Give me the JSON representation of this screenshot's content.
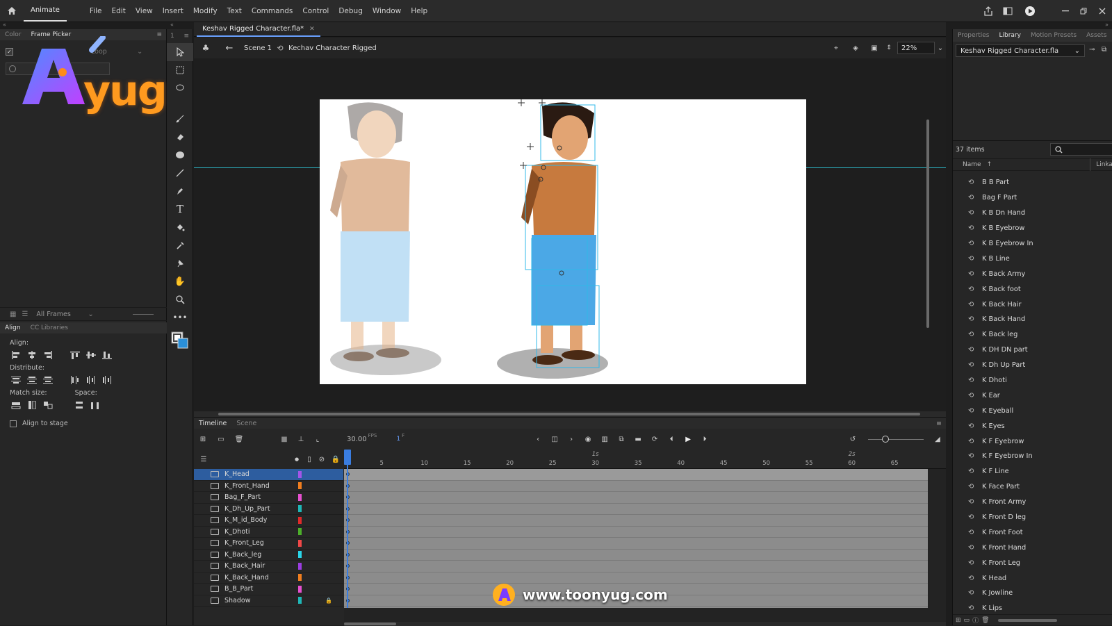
{
  "menubar": {
    "app_name": "Animate",
    "items": [
      "File",
      "Edit",
      "View",
      "Insert",
      "Modify",
      "Text",
      "Commands",
      "Control",
      "Debug",
      "Window",
      "Help"
    ]
  },
  "left_panel": {
    "tabs": [
      "Color",
      "Frame Picker"
    ],
    "loop_label": "Loop",
    "frames_filter": "All Frames",
    "align_tabs": [
      "Align",
      "CC Libraries"
    ],
    "align_label": "Align:",
    "distribute_label": "Distribute:",
    "match_size_label": "Match size:",
    "space_label": "Space:",
    "align_to_stage_label": "Align to stage"
  },
  "document": {
    "tab_title": "Keshav Rigged Character.fla*",
    "scene_label": "Scene 1",
    "symbol_label": "Kechav Character Rigged",
    "zoom": "22%"
  },
  "timeline": {
    "tabs": [
      "Timeline",
      "Scene"
    ],
    "fps_value": "30.00",
    "fps_unit": "FPS",
    "current_frame": "1",
    "frame_unit": "F",
    "ruler_ticks": [
      5,
      10,
      15,
      20,
      25,
      30,
      35,
      40,
      45,
      50,
      55,
      60,
      65
    ],
    "seconds_marks": [
      "1s",
      "2s"
    ],
    "layers": [
      {
        "name": "K_Head",
        "color": "#a255e8",
        "selected": true
      },
      {
        "name": "K_Front_Hand",
        "color": "#f07e1f",
        "selected": false
      },
      {
        "name": "Bag_F_Part",
        "color": "#e650d0",
        "selected": false
      },
      {
        "name": "K_Dh_Up_Part",
        "color": "#1fb7b7",
        "selected": false
      },
      {
        "name": "K_M_id_Body",
        "color": "#e02a2a",
        "selected": false
      },
      {
        "name": "K_Dhoti",
        "color": "#4caf2a",
        "selected": false
      },
      {
        "name": "K_Front_Leg",
        "color": "#f04848",
        "selected": false
      },
      {
        "name": "K_Back_leg",
        "color": "#2ad5e8",
        "selected": false
      },
      {
        "name": "K_Back_Hair",
        "color": "#9b3de0",
        "selected": false
      },
      {
        "name": "K_Back_Hand",
        "color": "#f07e1f",
        "selected": false
      },
      {
        "name": "B_B_Part",
        "color": "#e650d0",
        "selected": false
      },
      {
        "name": "Shadow",
        "color": "#1fb7b7",
        "selected": false,
        "locked": true
      }
    ]
  },
  "right_panel": {
    "tabs": [
      "Properties",
      "Library",
      "Motion Presets",
      "Assets"
    ],
    "library_file": "Keshav Rigged Character.fla",
    "item_count": "37 items",
    "col_name": "Name",
    "col_linkage": "Linka",
    "items": [
      "B B Part",
      "Bag F Part",
      "K B Dn Hand",
      "K B Eyebrow",
      "K B Eyebrow In",
      "K B Line",
      "K Back Army",
      "K Back foot",
      "K Back Hair",
      "K Back Hand",
      "K Back leg",
      "K DH DN part",
      "K Dh Up Part",
      "K Dhoti",
      "K Ear",
      "K Eyeball",
      "K Eyes",
      "K F Eyebrow",
      "K F Eyebrow In",
      "K F Line",
      "K Face Part",
      "K Front Army",
      "K Front D leg",
      "K Front Foot",
      "K Front Hand",
      "K Front Leg",
      "K Head",
      "K Jowline",
      "K Lips"
    ]
  },
  "branding": {
    "watermark": "yug",
    "url": "www.toonyug.com"
  },
  "colors": {
    "accent": "#2d5d9f",
    "guide": "#30c8d8",
    "playhead": "#3a7de0"
  }
}
